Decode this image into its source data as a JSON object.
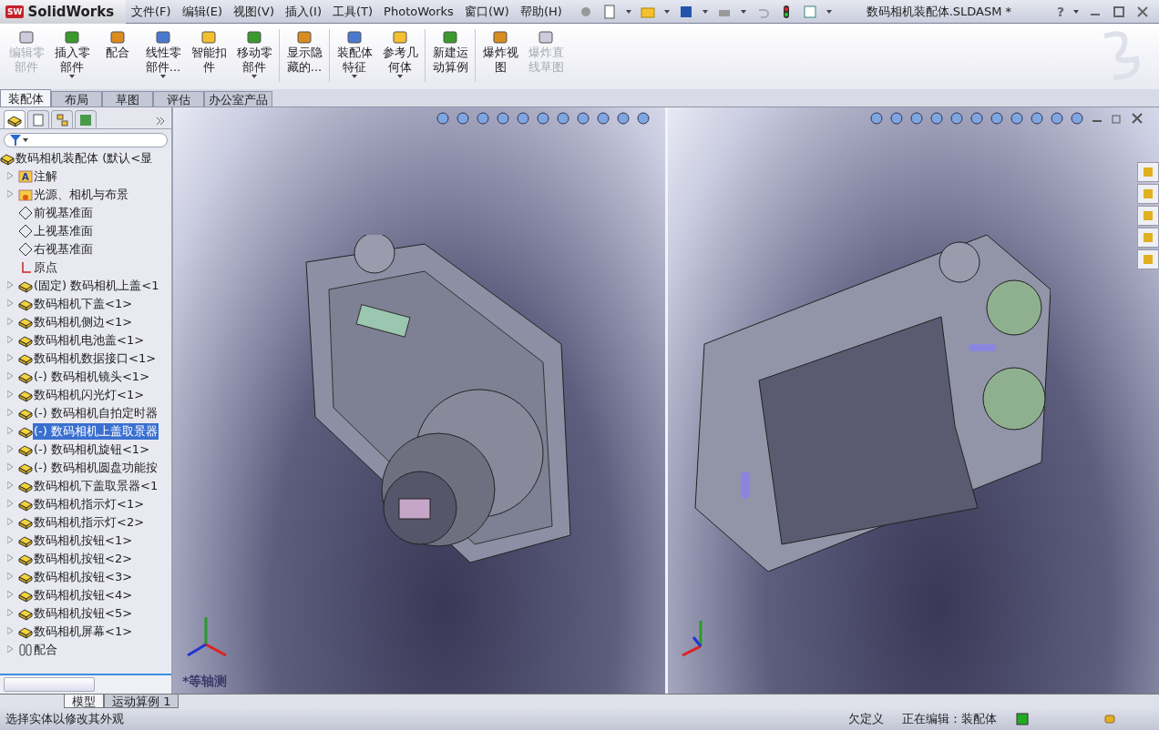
{
  "app": {
    "logo_mark": "SW",
    "logo": "SolidWorks",
    "title": "数码相机装配体.SLDASM *",
    "help": "?"
  },
  "menus": [
    "文件(F)",
    "编辑(E)",
    "视图(V)",
    "插入(I)",
    "工具(T)",
    "PhotoWorks",
    "窗口(W)",
    "帮助(H)"
  ],
  "commands": [
    {
      "label": "编辑零部件",
      "disabled": true,
      "dropdown": false
    },
    {
      "label": "插入零部件",
      "disabled": false,
      "dropdown": true
    },
    {
      "label": "配合",
      "disabled": false,
      "dropdown": false
    },
    {
      "label": "线性零部件...",
      "disabled": false,
      "dropdown": true
    },
    {
      "label": "智能扣件",
      "disabled": false,
      "dropdown": false
    },
    {
      "label": "移动零部件",
      "disabled": false,
      "dropdown": true
    },
    {
      "label": "显示隐藏的...",
      "disabled": false,
      "dropdown": false
    },
    {
      "label": "装配体特征",
      "disabled": false,
      "dropdown": true
    },
    {
      "label": "参考几何体",
      "disabled": false,
      "dropdown": true
    },
    {
      "label": "新建运动算例",
      "disabled": false,
      "dropdown": false
    },
    {
      "label": "爆炸视图",
      "disabled": false,
      "dropdown": false
    },
    {
      "label": "爆炸直线草图",
      "disabled": true,
      "dropdown": false
    }
  ],
  "command_tabs": [
    {
      "label": "装配体",
      "selected": true
    },
    {
      "label": "布局",
      "selected": false
    },
    {
      "label": "草图",
      "selected": false
    },
    {
      "label": "评估",
      "selected": false
    },
    {
      "label": "办公室产品",
      "selected": false
    }
  ],
  "tree": {
    "root": "数码相机装配体  (默认<显",
    "items": [
      {
        "kind": "annotation",
        "icon_text": "A",
        "label": "注解",
        "expandable": true,
        "selected": false
      },
      {
        "kind": "lights",
        "label": "光源、相机与布景",
        "expandable": true,
        "selected": false
      },
      {
        "kind": "plane",
        "label": "前视基准面",
        "expandable": false,
        "selected": false
      },
      {
        "kind": "plane",
        "label": "上视基准面",
        "expandable": false,
        "selected": false
      },
      {
        "kind": "plane",
        "label": "右视基准面",
        "expandable": false,
        "selected": false
      },
      {
        "kind": "origin",
        "label": "原点",
        "expandable": false,
        "selected": false
      },
      {
        "kind": "part",
        "label": "(固定) 数码相机上盖<1",
        "expandable": true,
        "selected": false
      },
      {
        "kind": "part",
        "label": "数码相机下盖<1>",
        "expandable": true,
        "selected": false
      },
      {
        "kind": "part",
        "label": "数码相机侧边<1>",
        "expandable": true,
        "selected": false
      },
      {
        "kind": "part",
        "label": "数码相机电池盖<1>",
        "expandable": true,
        "selected": false
      },
      {
        "kind": "part",
        "label": "数码相机数据接口<1>",
        "expandable": true,
        "selected": false
      },
      {
        "kind": "part",
        "label": "(-) 数码相机镜头<1>",
        "expandable": true,
        "selected": false
      },
      {
        "kind": "part",
        "label": "数码相机闪光灯<1>",
        "expandable": true,
        "selected": false
      },
      {
        "kind": "part",
        "label": "(-) 数码相机自拍定时器",
        "expandable": true,
        "selected": false
      },
      {
        "kind": "part",
        "label": "(-) 数码相机上盖取景器",
        "expandable": true,
        "selected": true
      },
      {
        "kind": "part",
        "label": "(-) 数码相机旋钮<1>",
        "expandable": true,
        "selected": false
      },
      {
        "kind": "part",
        "label": "(-) 数码相机圆盘功能按",
        "expandable": true,
        "selected": false
      },
      {
        "kind": "part",
        "label": "数码相机下盖取景器<1",
        "expandable": true,
        "selected": false
      },
      {
        "kind": "part",
        "label": "数码相机指示灯<1>",
        "expandable": true,
        "selected": false
      },
      {
        "kind": "part",
        "label": "数码相机指示灯<2>",
        "expandable": true,
        "selected": false
      },
      {
        "kind": "part",
        "label": "数码相机按钮<1>",
        "expandable": true,
        "selected": false
      },
      {
        "kind": "part",
        "label": "数码相机按钮<2>",
        "expandable": true,
        "selected": false
      },
      {
        "kind": "part",
        "label": "数码相机按钮<3>",
        "expandable": true,
        "selected": false
      },
      {
        "kind": "part",
        "label": "数码相机按钮<4>",
        "expandable": true,
        "selected": false
      },
      {
        "kind": "part",
        "label": "数码相机按钮<5>",
        "expandable": true,
        "selected": false
      },
      {
        "kind": "part",
        "label": "数码相机屏幕<1>",
        "expandable": true,
        "selected": false
      },
      {
        "kind": "mates",
        "label": "配合",
        "expandable": true,
        "selected": false
      }
    ]
  },
  "viewports": [
    {
      "kind": "front",
      "view_label": "*等轴测"
    },
    {
      "kind": "back"
    }
  ],
  "bottom_tabs": [
    {
      "label": "模型",
      "selected": true
    },
    {
      "label": "运动算例 1",
      "selected": false
    }
  ],
  "status_bar": {
    "message": "选择实体以修改其外观",
    "definition": "欠定义",
    "editing": "正在编辑：装配体"
  }
}
